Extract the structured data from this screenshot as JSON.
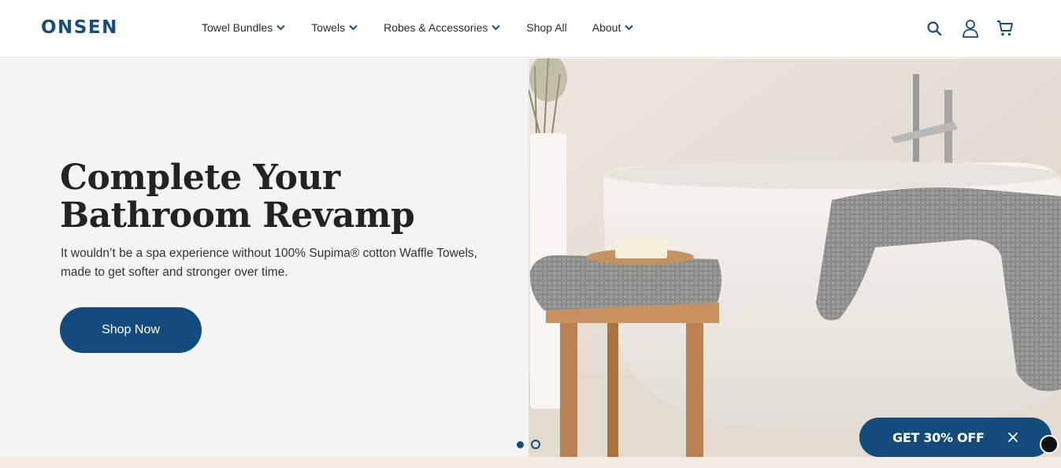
{
  "brand": {
    "logo": "ONSEN",
    "color": "#144f80"
  },
  "nav": {
    "items": [
      {
        "label": "Towel Bundles",
        "has_dropdown": true
      },
      {
        "label": "Towels",
        "has_dropdown": true
      },
      {
        "label": "Robes & Accessories",
        "has_dropdown": true
      },
      {
        "label": "Shop All",
        "has_dropdown": false
      },
      {
        "label": "About",
        "has_dropdown": true
      }
    ]
  },
  "header_icons": [
    "search-icon",
    "account-icon",
    "cart-icon"
  ],
  "hero": {
    "title": "Complete Your Bathroom Revamp",
    "subtitle": "It wouldn’t be a spa experience without 100% Supima® cotton Waffle Towels, made to get softer and stronger over time.",
    "cta_label": "Shop Now",
    "slide_count": 2,
    "active_slide": 1
  },
  "promo": {
    "label": "GET 30% OFF"
  },
  "colors": {
    "accent": "#124b7c",
    "hero_bg": "#f4f4f4",
    "band": "#f4ebe3"
  }
}
